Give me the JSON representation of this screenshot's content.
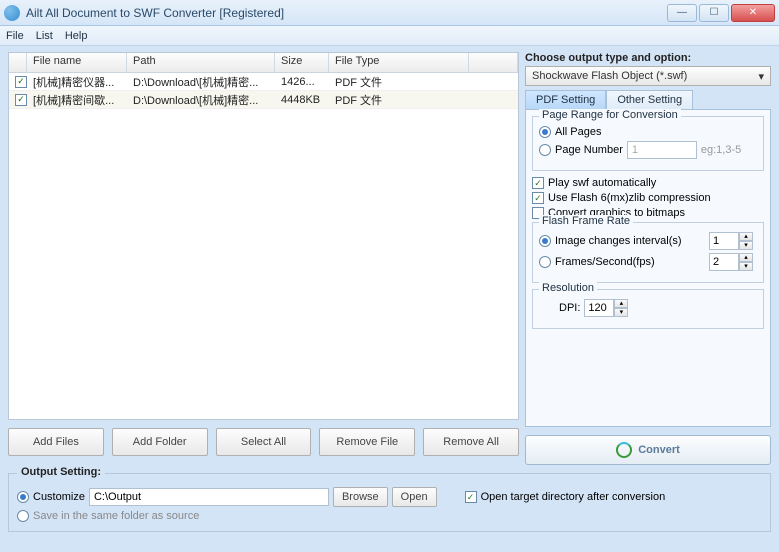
{
  "window": {
    "title": "Ailt All Document to SWF Converter [Registered]"
  },
  "menu": {
    "file": "File",
    "list": "List",
    "help": "Help"
  },
  "table": {
    "headers": {
      "name": "File name",
      "path": "Path",
      "size": "Size",
      "type": "File Type"
    },
    "rows": [
      {
        "checked": true,
        "name": "[机械]精密仪器...",
        "path": "D:\\Download\\[机械]精密...",
        "size": "1426...",
        "type": "PDF 文件"
      },
      {
        "checked": true,
        "name": "[机械]精密间歇...",
        "path": "D:\\Download\\[机械]精密...",
        "size": "4448KB",
        "type": "PDF 文件"
      }
    ]
  },
  "buttons": {
    "add_files": "Add Files",
    "add_folder": "Add Folder",
    "select_all": "Select All",
    "remove_file": "Remove File",
    "remove_all": "Remove All",
    "convert": "Convert"
  },
  "right": {
    "choose_label": "Choose output type and option:",
    "output_type": "Shockwave Flash Object (*.swf)",
    "tab_pdf": "PDF Setting",
    "tab_other": "Other Setting",
    "page_range_label": "Page Range for Conversion",
    "all_pages": "All Pages",
    "page_number": "Page Number",
    "page_number_value": "1",
    "page_number_hint": "eg:1,3-5",
    "play_auto": "Play swf automatically",
    "zlib": "Use Flash 6(mx)zlib compression",
    "bitmaps": "Convert graphics to bitmaps",
    "frame_rate_label": "Flash Frame Rate",
    "interval": "Image changes interval(s)",
    "interval_value": "1",
    "fps": "Frames/Second(fps)",
    "fps_value": "2",
    "resolution_label": "Resolution",
    "dpi_label": "DPI:",
    "dpi_value": "120"
  },
  "output": {
    "group_label": "Output Setting:",
    "customize": "Customize",
    "path": "C:\\Output",
    "browse": "Browse",
    "open": "Open",
    "same_folder": "Save in the same folder as source",
    "open_target": "Open target directory after conversion"
  }
}
